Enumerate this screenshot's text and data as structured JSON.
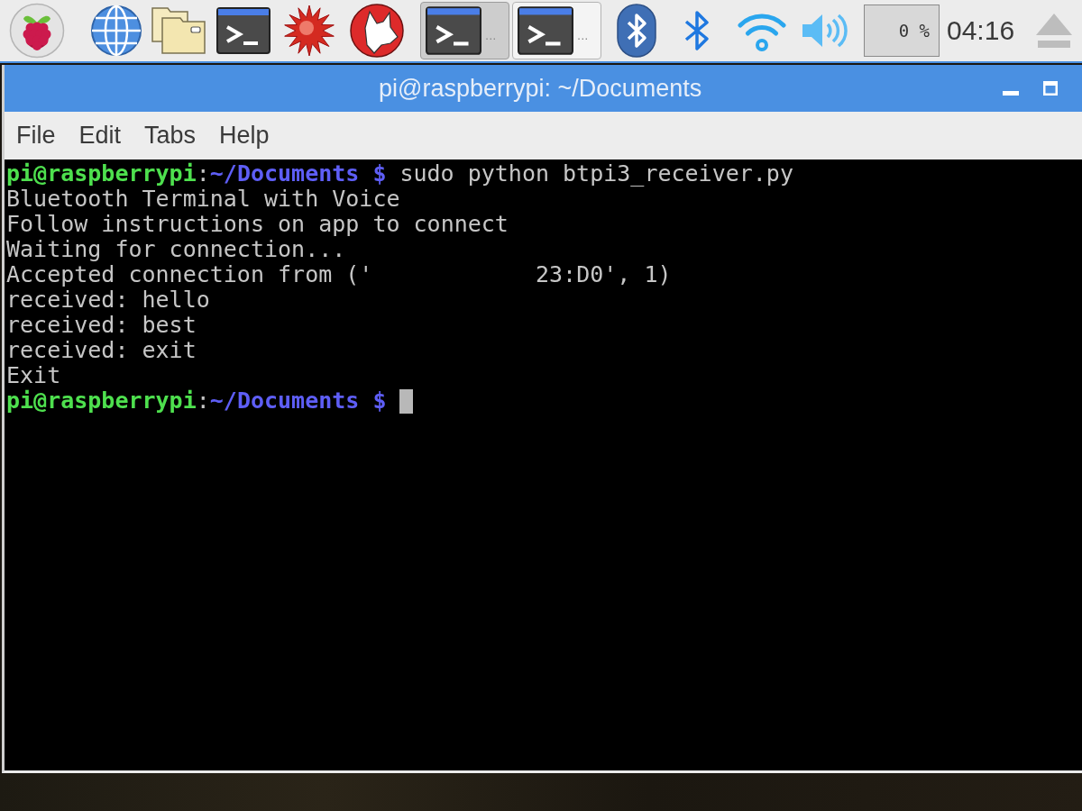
{
  "taskbar": {
    "tasks": [
      {
        "label": "...",
        "selected": true
      },
      {
        "label": "...",
        "selected": false
      }
    ],
    "cpu_usage": "0 %",
    "clock": "04:16"
  },
  "window": {
    "title": "pi@raspberrypi: ~/Documents",
    "menu": [
      "File",
      "Edit",
      "Tabs",
      "Help"
    ]
  },
  "terminal": {
    "lines": [
      {
        "kind": "prompt",
        "user_host": "pi@raspberrypi",
        "separator": ":",
        "path": "~/Documents $",
        "command": "sudo python btpi3_receiver.py",
        "cursor": false
      },
      {
        "kind": "output",
        "text": "Bluetooth Terminal with Voice"
      },
      {
        "kind": "output",
        "text": "Follow instructions on app to connect"
      },
      {
        "kind": "output",
        "text": "Waiting for connection..."
      },
      {
        "kind": "output",
        "text": "Accepted connection from ('            23:D0', 1)"
      },
      {
        "kind": "output",
        "text": "received: hello"
      },
      {
        "kind": "output",
        "text": "received: best"
      },
      {
        "kind": "output",
        "text": "received: exit"
      },
      {
        "kind": "output",
        "text": "Exit"
      },
      {
        "kind": "prompt",
        "user_host": "pi@raspberrypi",
        "separator": ":",
        "path": "~/Documents $",
        "cursor": true
      }
    ]
  }
}
